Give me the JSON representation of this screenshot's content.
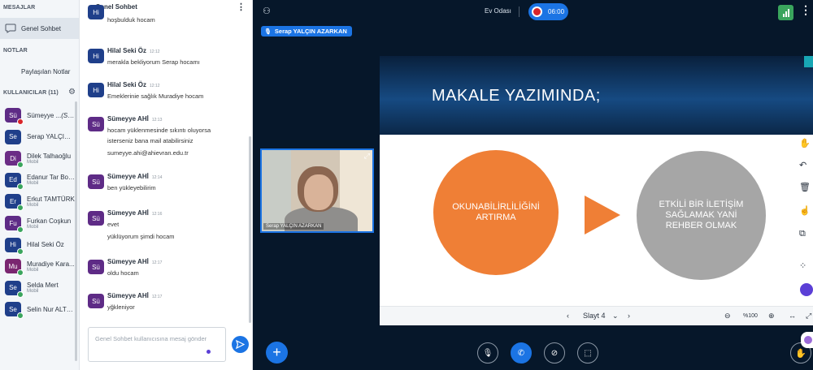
{
  "sidebar": {
    "messages_title": "MESAJLAR",
    "public_chat_label": "Genel Sohbet",
    "notes_title": "NOTLAR",
    "shared_notes_label": "Paylaşılan Notlar",
    "users_title": "KULLANICILAR (11)",
    "users": [
      {
        "initials": "Sü",
        "name": "Sümeyye ...",
        "you": "(Sen)",
        "sub": "",
        "color": "#5e2b86",
        "badge": "#d9252a"
      },
      {
        "initials": "Se",
        "name": "Serap YALÇIN ...",
        "sub": "",
        "color": "#1f3f8a",
        "badge": ""
      },
      {
        "initials": "Di",
        "name": "Dilek Talhaoğlu",
        "sub": "Mobil",
        "color": "#6b2d86",
        "badge": "#3aa55d"
      },
      {
        "initials": "Ed",
        "name": "Edanur Tar Bol...",
        "sub": "Mobil",
        "color": "#1f3f8a",
        "badge": "#3aa55d"
      },
      {
        "initials": "Er",
        "name": "Erkut TAMTÜRK",
        "sub": "Mobil",
        "color": "#1f3f8a",
        "badge": "#3aa55d"
      },
      {
        "initials": "Fu",
        "name": "Furkan Coşkun",
        "sub": "Mobil",
        "color": "#5e2b86",
        "badge": "#3aa55d"
      },
      {
        "initials": "Hi",
        "name": "Hilal Seki Öz",
        "sub": "",
        "color": "#1f3f8a",
        "badge": "#3aa55d"
      },
      {
        "initials": "Mu",
        "name": "Muradiye Kara...",
        "sub": "Mobil",
        "color": "#7a2670",
        "badge": "#3aa55d"
      },
      {
        "initials": "Se",
        "name": "Selda Mert",
        "sub": "Mobil",
        "color": "#1f3f8a",
        "badge": "#3aa55d"
      },
      {
        "initials": "Se",
        "name": "Selin Nur ALTUN",
        "sub": "",
        "color": "#1f3f8a",
        "badge": "#3aa55d"
      }
    ]
  },
  "chat": {
    "title": "Genel Sohbet",
    "placeholder": "Genel Sohbet kullanıcısına mesaj gönder",
    "messages": [
      {
        "initials": "Hi",
        "name": "",
        "time": "",
        "lines": [
          "hoşbulduk hocam"
        ],
        "color": "#1f3f8a"
      },
      {
        "initials": "Hi",
        "name": "Hilal Seki Öz",
        "time": "12:12",
        "lines": [
          "merakla bekliyorum Serap hocamı"
        ],
        "color": "#1f3f8a"
      },
      {
        "initials": "Hi",
        "name": "Hilal Seki Öz",
        "time": "12:12",
        "lines": [
          "Emeklerinie sağlık Muradiye hocam"
        ],
        "color": "#1f3f8a"
      },
      {
        "initials": "Sü",
        "name": "Sümeyye AHİ",
        "time": "12:13",
        "lines": [
          "hocam yüklenmesinde sıkıntı oluyorsa",
          "isterseniz bana mail atabilirsiniz",
          "sumeyye.ahi@ahievran.edu.tr"
        ],
        "color": "#5e2b86"
      },
      {
        "initials": "Sü",
        "name": "Sümeyye AHİ",
        "time": "12:14",
        "lines": [
          "ben yükleyebilirim"
        ],
        "color": "#5e2b86"
      },
      {
        "initials": "Sü",
        "name": "Sümeyye AHİ",
        "time": "12:16",
        "lines": [
          "evet",
          "yüklüyorum şimdi hocam"
        ],
        "color": "#5e2b86"
      },
      {
        "initials": "Sü",
        "name": "Sümeyye AHİ",
        "time": "12:17",
        "lines": [
          "oldu hocam"
        ],
        "color": "#5e2b86"
      },
      {
        "initials": "Sü",
        "name": "Sümeyye AHİ",
        "time": "12:17",
        "lines": [
          "yğkleniyor"
        ],
        "color": "#5e2b86"
      }
    ]
  },
  "main": {
    "room_name": "Ev Odası",
    "timer": "06:00",
    "speaker": "Serap YALÇIN AZARKAN",
    "webcam_name": "Serap YALÇIN AZARKAN",
    "slide": {
      "title": "MAKALE YAZIMINDA;",
      "left_circle": "OKUNABİLİRLİLİĞİNİ ARTIRMA",
      "right_circle": "ETKİLİ BİR İLETİŞİM SAĞLAMAK YANİ REHBER OLMAK"
    },
    "slide_nav": {
      "current": "Slayt 4",
      "zoom": "%100"
    }
  },
  "colors": {
    "accent": "#1b74e4",
    "orange": "#ef7f36",
    "gray": "#a6a6a6",
    "online": "#3aa55d"
  }
}
